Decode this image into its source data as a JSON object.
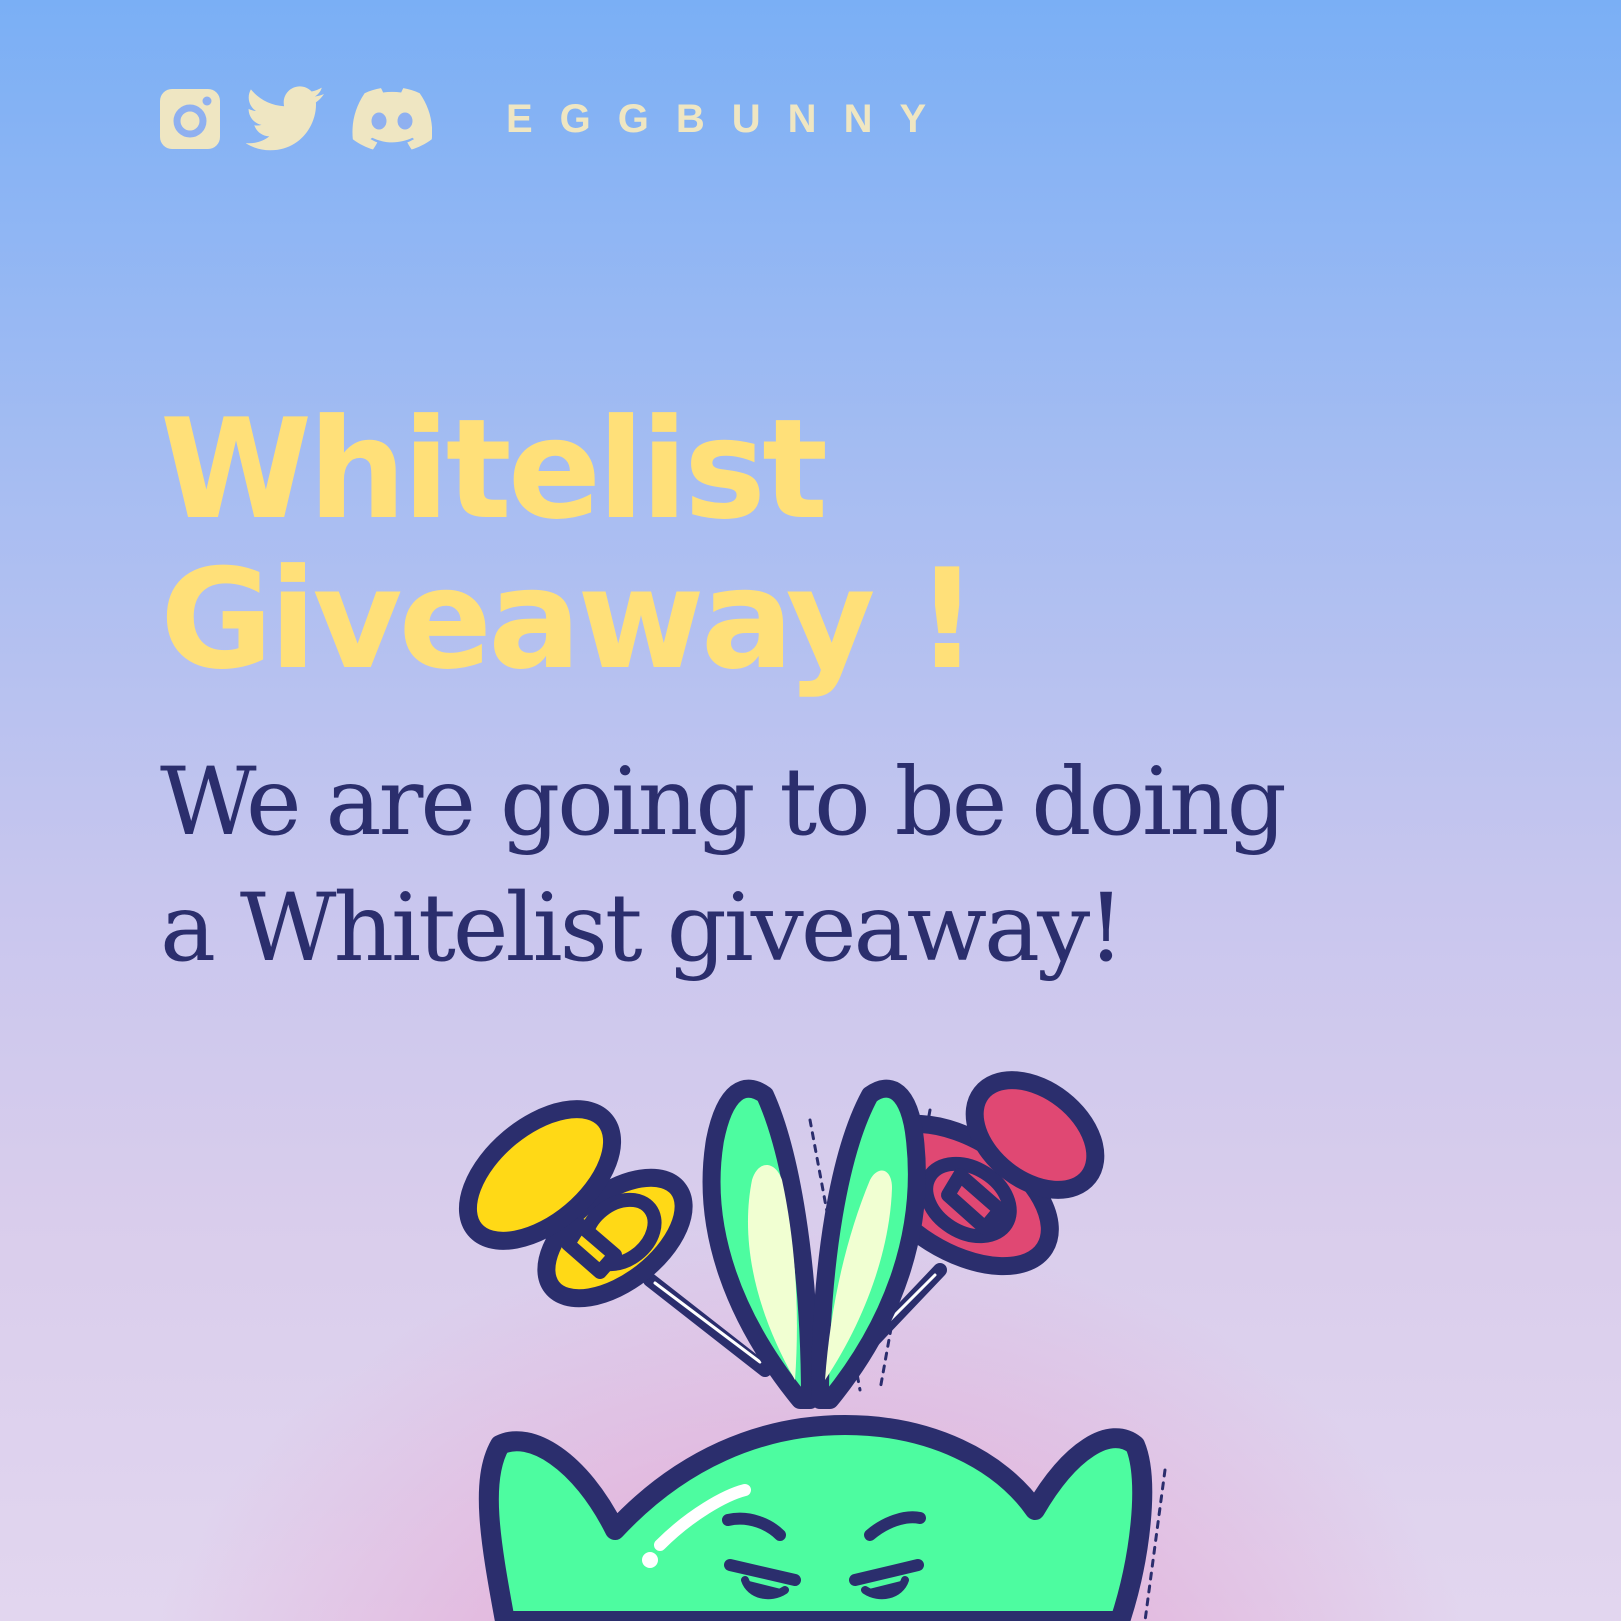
{
  "header": {
    "social_icons": [
      "instagram-icon",
      "twitter-icon",
      "discord-icon"
    ],
    "brand": "EGGBUNNY"
  },
  "headline": {
    "line1": "Whitelist",
    "line2": "Giveaway !"
  },
  "subtext": {
    "line1": "We are going to be doing",
    "line2": "a Whitelist giveaway!"
  },
  "colors": {
    "headline": "#ffe079",
    "subtext": "#2b2e6d",
    "icons": "#efe6c2",
    "mascot_green": "#4dfca0",
    "pin_yellow": "#ffd916",
    "pin_red": "#e04873",
    "outline": "#2b2e6d"
  }
}
